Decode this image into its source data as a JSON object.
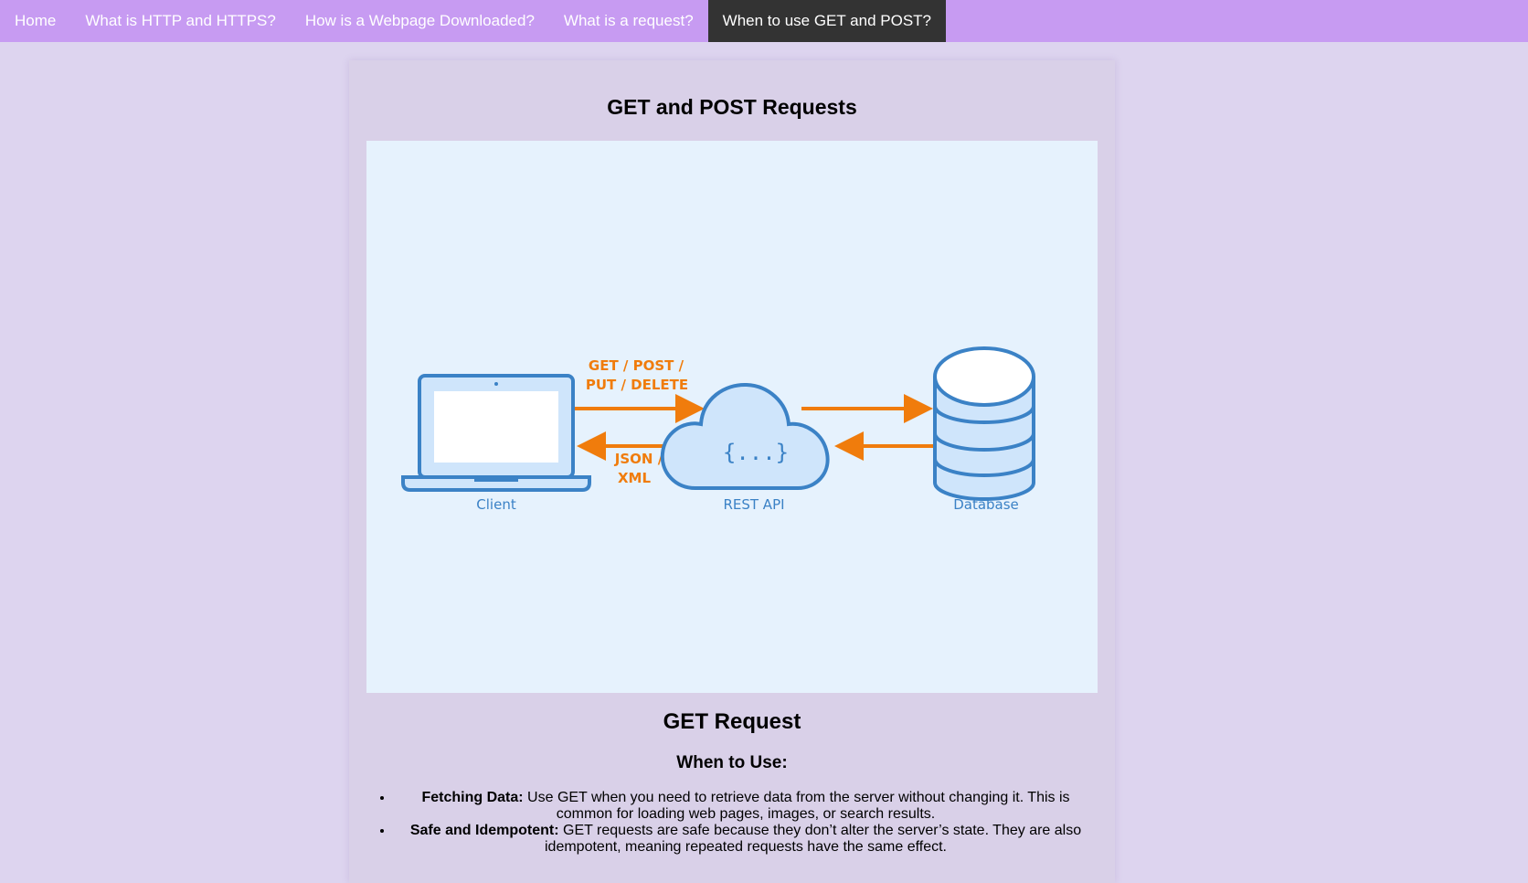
{
  "nav": {
    "items": [
      {
        "label": "Home"
      },
      {
        "label": "What is HTTP and HTTPS?"
      },
      {
        "label": "How is a Webpage Downloaded?"
      },
      {
        "label": "What is a request?"
      },
      {
        "label": "When to use GET and POST?"
      }
    ],
    "active_index": 4
  },
  "page": {
    "title": "GET and POST Requests"
  },
  "diagram": {
    "request_label_line1": "GET / POST /",
    "request_label_line2": "PUT / DELETE",
    "response_label_line1": "JSON /",
    "response_label_line2": "XML",
    "api_symbol": "{...}",
    "client_label": "Client",
    "api_label": "REST API",
    "database_label": "Database",
    "colors": {
      "stroke": "#3b82c6",
      "fill": "#cfe5fb",
      "arrow": "#f07c0c",
      "background": "#e6f2fd"
    }
  },
  "get_section": {
    "heading": "GET Request",
    "subheading": "When to Use:",
    "bullets": [
      {
        "term": "Fetching Data:",
        "text": " Use GET when you need to retrieve data from the server without changing it. This is common for loading web pages, images, or search results."
      },
      {
        "term": "Safe and Idempotent:",
        "text": " GET requests are safe because they don’t alter the server’s state. They are also idempotent, meaning repeated requests have the same effect."
      }
    ]
  }
}
